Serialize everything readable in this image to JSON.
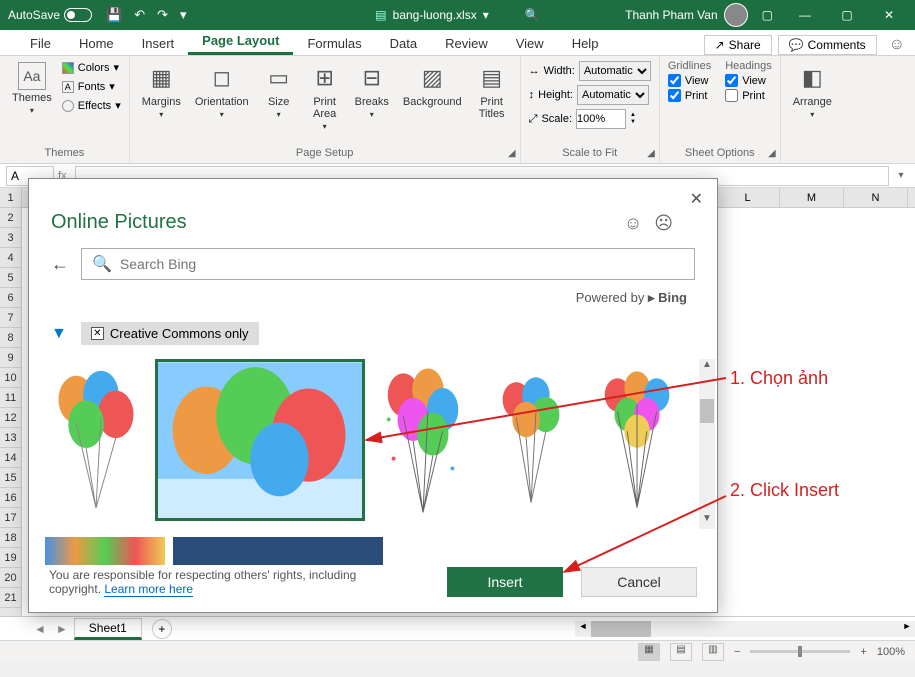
{
  "titlebar": {
    "autosave_label": "AutoSave",
    "autosave_state": "Off",
    "filename": "bang-luong.xlsx",
    "saved_suffix": " ",
    "user": "Thanh Pham Van"
  },
  "tabs": {
    "items": [
      "File",
      "Home",
      "Insert",
      "Page Layout",
      "Formulas",
      "Data",
      "Review",
      "View",
      "Help"
    ],
    "active": "Page Layout",
    "share": "Share",
    "comments": "Comments"
  },
  "ribbon": {
    "themes": {
      "themes_btn": "Themes",
      "colors": "Colors",
      "fonts": "Fonts",
      "effects": "Effects",
      "label": "Themes"
    },
    "page_setup": {
      "margins": "Margins",
      "orientation": "Orientation",
      "size": "Size",
      "print_area": "Print\nArea",
      "breaks": "Breaks",
      "background": "Background",
      "print_titles": "Print\nTitles",
      "label": "Page Setup"
    },
    "scale": {
      "width_label": "Width:",
      "width_value": "Automatic",
      "height_label": "Height:",
      "height_value": "Automatic",
      "scale_label": "Scale:",
      "scale_value": "100%",
      "label": "Scale to Fit"
    },
    "sheet_options": {
      "gridlines": "Gridlines",
      "headings": "Headings",
      "view": "View",
      "print": "Print",
      "label": "Sheet Options"
    },
    "arrange": {
      "arrange": "Arrange",
      "label": ""
    }
  },
  "dialog": {
    "title": "Online Pictures",
    "search_placeholder": "Search Bing",
    "powered_prefix": "Powered by ",
    "powered_brand": "Bing",
    "cc_only": "Creative Commons only",
    "disclaimer_pre": "You are responsible for respecting others' rights, including copyright. ",
    "disclaimer_link": "Learn more here",
    "insert": "Insert",
    "cancel": "Cancel"
  },
  "grid": {
    "columns": [
      "L",
      "M",
      "N"
    ],
    "rows": [
      "1",
      "2",
      "3",
      "4",
      "5",
      "6",
      "7",
      "8",
      "9",
      "10",
      "11",
      "12",
      "13",
      "14",
      "15",
      "16",
      "17",
      "18",
      "19",
      "20",
      "21"
    ]
  },
  "sheets": {
    "active": "Sheet1"
  },
  "statusbar": {
    "zoom": "100%"
  },
  "annotations": {
    "step1": "1. Chọn ảnh",
    "step2": "2. Click Insert"
  }
}
